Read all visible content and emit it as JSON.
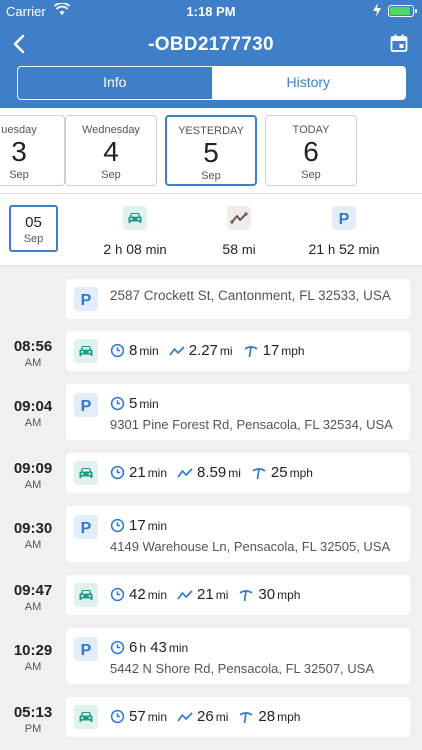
{
  "status": {
    "carrier": "Carrier",
    "time": "1:18 PM"
  },
  "header": {
    "title": "-OBD2177730"
  },
  "tabs": [
    {
      "label": "Info"
    },
    {
      "label": "History"
    }
  ],
  "days": [
    {
      "name": "uesday",
      "num": "3",
      "month": "Sep"
    },
    {
      "name": "Wednesday",
      "num": "4",
      "month": "Sep"
    },
    {
      "name": "YESTERDAY",
      "num": "5",
      "month": "Sep"
    },
    {
      "name": "TODAY",
      "num": "6",
      "month": "Sep"
    }
  ],
  "summary": {
    "date_num": "05",
    "date_month": "Sep",
    "drive_h": "2",
    "drive_h_unit": "h",
    "drive_m": "08",
    "drive_m_unit": "min",
    "dist": "58",
    "dist_unit": "mi",
    "park_h": "21",
    "park_h_unit": "h",
    "park_m": "52",
    "park_m_unit": "min"
  },
  "icons": {
    "back": "chevron-left-icon",
    "calendar": "calendar-icon",
    "car": "car-icon",
    "route": "route-icon",
    "parking": "parking-icon",
    "clock": "clock-icon",
    "speed": "speed-icon"
  },
  "colors": {
    "primary": "#3e7fc7",
    "car": "#1e9a86",
    "parking": "#2f78d2"
  },
  "events": [
    {
      "time": "",
      "ampm": "",
      "type": "parking",
      "duration": "",
      "address": "2587 Crockett St, Cantonment, FL 32533, USA"
    },
    {
      "time": "08:56",
      "ampm": "AM",
      "type": "drive",
      "duration": "8",
      "distance": "2.27",
      "speed": "17"
    },
    {
      "time": "09:04",
      "ampm": "AM",
      "type": "parking",
      "duration": "5",
      "address": "9301 Pine Forest Rd, Pensacola, FL 32534, USA"
    },
    {
      "time": "09:09",
      "ampm": "AM",
      "type": "drive",
      "duration": "21",
      "distance": "8.59",
      "speed": "25"
    },
    {
      "time": "09:30",
      "ampm": "AM",
      "type": "parking",
      "duration": "17",
      "address": "4149 Warehouse Ln, Pensacola, FL 32505, USA"
    },
    {
      "time": "09:47",
      "ampm": "AM",
      "type": "drive",
      "duration": "42",
      "distance": "21",
      "speed": "30"
    },
    {
      "time": "10:29",
      "ampm": "AM",
      "type": "parking",
      "duration_h": "6",
      "duration": "43",
      "address": "5442 N Shore Rd, Pensacola, FL 32507, USA"
    },
    {
      "time": "05:13",
      "ampm": "PM",
      "type": "drive",
      "duration": "57",
      "distance": "26",
      "speed": "28"
    }
  ],
  "units": {
    "min": "min",
    "mi": "mi",
    "mph": "mph",
    "h": "h"
  }
}
